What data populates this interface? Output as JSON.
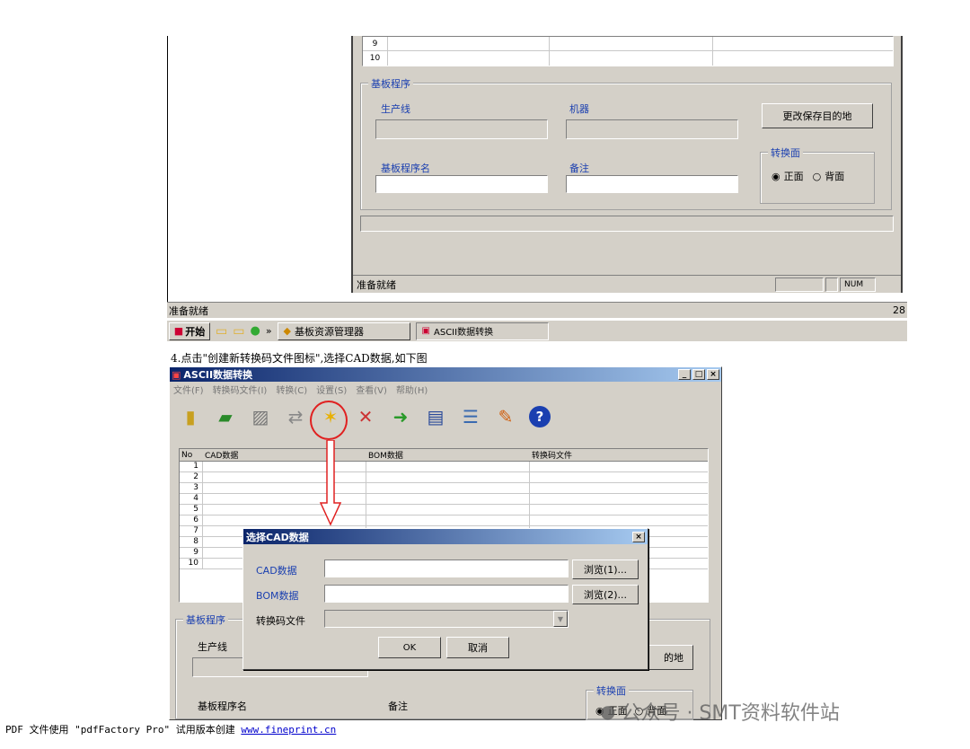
{
  "top_window": {
    "rows": [
      "9",
      "10"
    ],
    "group_title": "基板程序",
    "production_line_label": "生产线",
    "machine_label": "机器",
    "change_dest_button": "更改保存目的地",
    "convert_side_title": "转换面",
    "side_front": "正面",
    "side_back": "背面",
    "program_name_label": "基板程序名",
    "remark_label": "备注",
    "status_text": "准备就绪",
    "status_num": "NUM"
  },
  "desktop_status": "准备就绪",
  "desktop_status_right": "28",
  "taskbar": {
    "start_label": "开始",
    "chevron": "»",
    "task1": "基板资源管理器",
    "task2": "ASCII数据转换"
  },
  "instruction": "4.点击\"创建新转换码文件图标\",选择CAD数据,如下图",
  "app": {
    "title": "ASCII数据转换",
    "min": "_",
    "max": "□",
    "close": "×",
    "menus": [
      "文件(F)",
      "转换码文件(I)",
      "转换(C)",
      "设置(S)",
      "查看(V)",
      "帮助(H)"
    ],
    "toolbar_icons": [
      "open-folder-icon",
      "message-icon",
      "edit-note-icon",
      "refresh-icon",
      "new-file-icon",
      "delete-file-icon",
      "export-icon",
      "book-icon",
      "list-icon",
      "settings-icon",
      "help-icon"
    ],
    "grid_headers": [
      "No",
      "CAD数据",
      "BOM数据",
      "转换码文件"
    ],
    "grid_rows": [
      "1",
      "2",
      "3",
      "4",
      "5",
      "6",
      "7",
      "8",
      "9",
      "10"
    ],
    "group_title": "基板程序",
    "production_line_label": "生产线",
    "program_name_label": "基板程序名",
    "remark_label": "备注",
    "dest_button_partial": "的地",
    "convert_side_title": "转换面",
    "side_front": "正面",
    "side_back": "背面"
  },
  "dialog": {
    "title": "选择CAD数据",
    "close": "×",
    "cad_label": "CAD数据",
    "bom_label": "BOM数据",
    "convert_label": "转换码文件",
    "browse1": "浏览(1)...",
    "browse2": "浏览(2)...",
    "ok": "OK",
    "cancel": "取消"
  },
  "footer": {
    "text": "PDF 文件使用 \"pdfFactory Pro\" 试用版本创建 ",
    "link": "www.fineprint.cn"
  },
  "watermark": "公众号 · SMT资料软件站",
  "colors": {
    "accent": "#1a3fb0",
    "highlight": "#e02020",
    "window": "#d4d0c8"
  }
}
